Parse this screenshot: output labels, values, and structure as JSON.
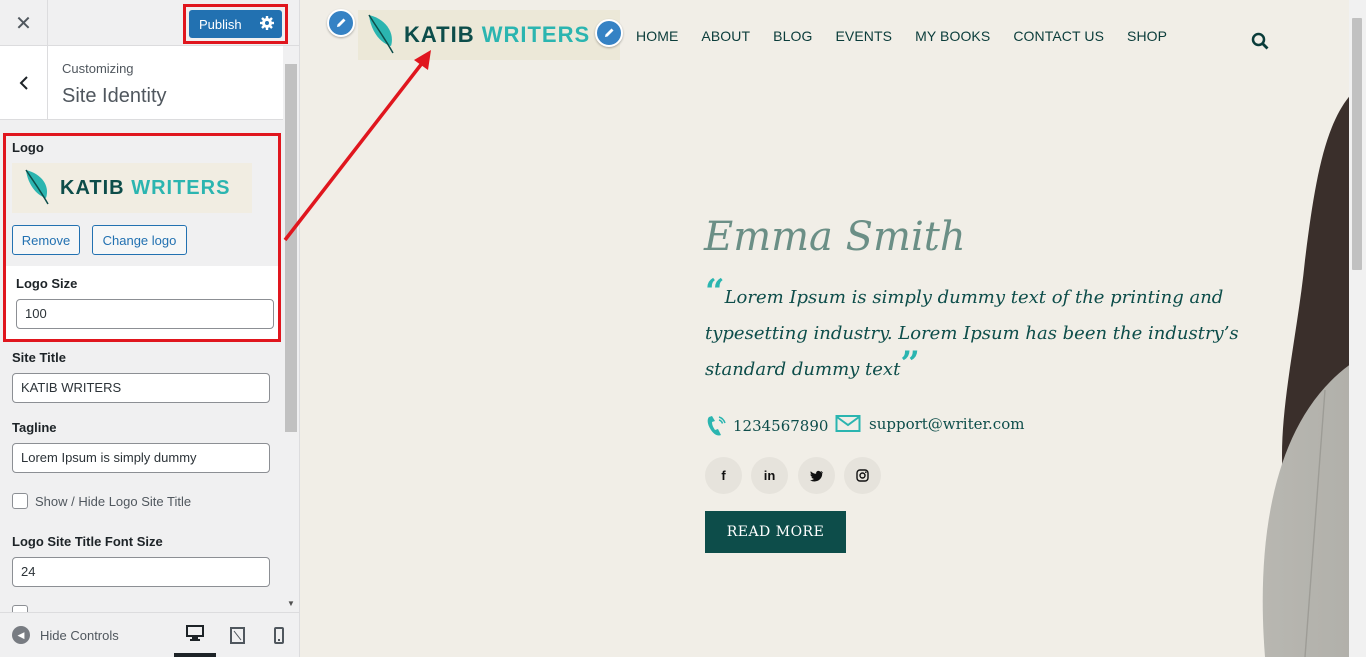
{
  "customizer": {
    "close_glyph": "✕",
    "publish_label": "Publish",
    "back_glyph": "‹",
    "customizing_label": "Customizing",
    "section_title": "Site Identity",
    "logo_label": "Logo",
    "logo_word_1": "KATIB",
    "logo_word_2": "WRITERS",
    "remove_label": "Remove",
    "change_logo_label": "Change logo",
    "logo_size_label": "Logo Size",
    "logo_size_value": "100",
    "site_title_label": "Site Title",
    "site_title_value": "KATIB WRITERS",
    "tagline_label": "Tagline",
    "tagline_value": "Lorem Ipsum is simply dummy",
    "show_hide_label": "Show / Hide Logo Site Title",
    "font_size_label": "Logo Site Title Font Size",
    "font_size_value": "24",
    "hide_controls_label": "Hide Controls"
  },
  "site": {
    "logo_word_1": "KATIB",
    "logo_word_2": "WRITERS",
    "nav": [
      "HOME",
      "ABOUT",
      "BLOG",
      "EVENTS",
      "MY BOOKS",
      "CONTACT US",
      "SHOP"
    ],
    "hero": {
      "name": "Emma Smith",
      "quote": "Lorem Ipsum is simply dummy text of the printing and typesetting industry. Lorem Ipsum has been the industry’s standard dummy text",
      "phone": "1234567890",
      "email": "support@writer.com",
      "social": [
        "f",
        "in",
        "twitter",
        "instagram"
      ],
      "button": "READ MORE"
    }
  },
  "colors": {
    "publish": "#2271b1",
    "highlight": "#e0161e",
    "brand_dark": "#0d4d4a",
    "brand_teal": "#2bb5b0",
    "preview_bg": "#f1eee7"
  },
  "icons": [
    "close-icon",
    "gear-icon",
    "chevron-left-icon",
    "feather-icon",
    "pencil-icon",
    "search-icon",
    "phone-icon",
    "mail-icon",
    "facebook-icon",
    "linkedin-icon",
    "twitter-icon",
    "instagram-icon",
    "desktop-icon",
    "tablet-icon",
    "mobile-icon"
  ]
}
